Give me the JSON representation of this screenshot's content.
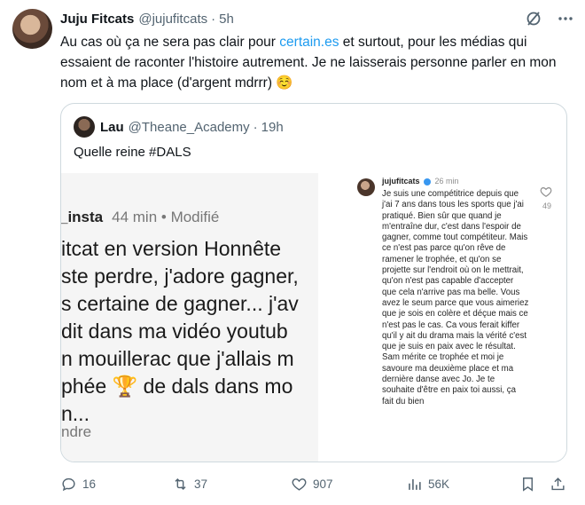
{
  "tweet": {
    "author_name": "Juju Fitcats",
    "author_handle": "@jujufitcats",
    "separator": "·",
    "time": "5h",
    "text_before_link": "Au cas où ça ne sera pas clair pour ",
    "link_text": "certain.es",
    "text_after_link": " et surtout, pour les médias qui essaient de raconter l'histoire autrement. Je ne laisserais personne parler en mon nom et à ma place (d'argent mdrrr) ☺️"
  },
  "header_icons": [
    "grok-icon",
    "more-icon"
  ],
  "quote": {
    "author_name": "Lau",
    "author_handle": "@Theane_Academy",
    "separator": "·",
    "time": "19h",
    "text": "Quelle reine #DALS",
    "left_image": {
      "user": "_insta",
      "meta": "44 min • Modifié",
      "lines": [
        "itcat en version Honnête",
        "ste perdre, j'adore gagner,",
        "s certaine de gagner... j'av",
        "dit dans ma vidéo youtub",
        "n mouillerac que j'allais m",
        "phée 🏆 de dals dans mo",
        "n..."
      ],
      "tail": "ndre"
    },
    "right_image": {
      "user": "jujufitcats",
      "time": "26 min",
      "likes": "49",
      "text": "Je suis une compétitrice depuis que j'ai 7 ans dans tous les sports que j'ai pratiqué. Bien sûr que quand je m'entraîne dur, c'est dans l'espoir de gagner, comme tout compétiteur. Mais ce n'est pas parce qu'on rêve de ramener le trophée, et qu'on se projette sur l'endroit où on le mettrait, qu'on n'est pas capable d'accepter que cela n'arrive pas ma belle. Vous avez le seum parce que vous aimeriez que je sois en colère et déçue mais ce n'est pas le cas. Ca vous ferait kiffer qu'il y ait du drama mais la vérité c'est que je suis en paix avec le résultat. Sam mérite ce trophée et moi je savoure ma deuxième place et ma dernière danse avec Jo. Je te souhaite d'être en paix toi aussi, ça fait du bien"
    }
  },
  "actions": {
    "replies": "16",
    "retweets": "37",
    "likes": "907",
    "views": "56K"
  },
  "colors": {
    "accent": "#1d9bf0",
    "muted": "#536471",
    "border": "#cfd9de"
  }
}
